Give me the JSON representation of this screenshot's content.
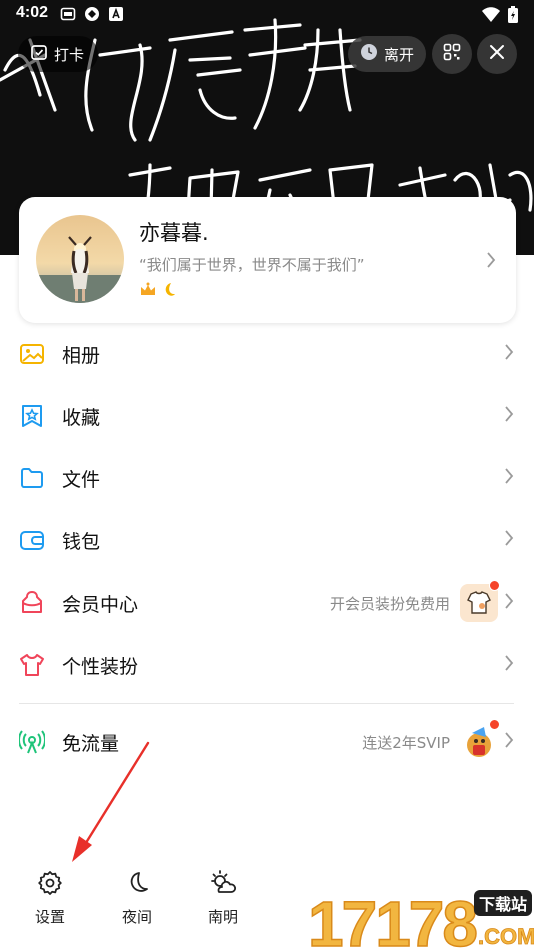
{
  "status_bar": {
    "time": "4:02"
  },
  "banner": {
    "checkin_label": "打卡",
    "leave_label": "离开",
    "handwriting_line1": "我们属于世界",
    "handwriting_line2": "世界不属于我们"
  },
  "profile": {
    "name": "亦暮暮.",
    "signature": "“我们属于世界，世界不属于我们”"
  },
  "menu": {
    "items": [
      {
        "label": "相册",
        "icon": "photo-album-icon",
        "color": "#f5b400"
      },
      {
        "label": "收藏",
        "icon": "favorites-icon",
        "color": "#1e9bf0"
      },
      {
        "label": "文件",
        "icon": "folder-icon",
        "color": "#1e9bf0"
      },
      {
        "label": "钱包",
        "icon": "wallet-icon",
        "color": "#1e9bf0"
      },
      {
        "label": "会员中心",
        "icon": "vip-icon",
        "color": "#f0455a",
        "trailing": "开会员装扮免费用"
      },
      {
        "label": "个性装扮",
        "icon": "tshirt-icon",
        "color": "#f0455a"
      },
      {
        "label": "免流量",
        "icon": "free-data-icon",
        "color": "#1fc47a",
        "trailing": "连送2年SVIP"
      }
    ]
  },
  "bottom_bar": {
    "settings_label": "设置",
    "night_label": "夜间",
    "weather_label": "南明"
  },
  "watermark": {
    "digits": "17178",
    "brand": "下载站",
    "domain": ".COM"
  },
  "colors": {
    "accent_red": "#e8302a",
    "text_primary": "#111111",
    "text_secondary": "#8a8a8a"
  }
}
